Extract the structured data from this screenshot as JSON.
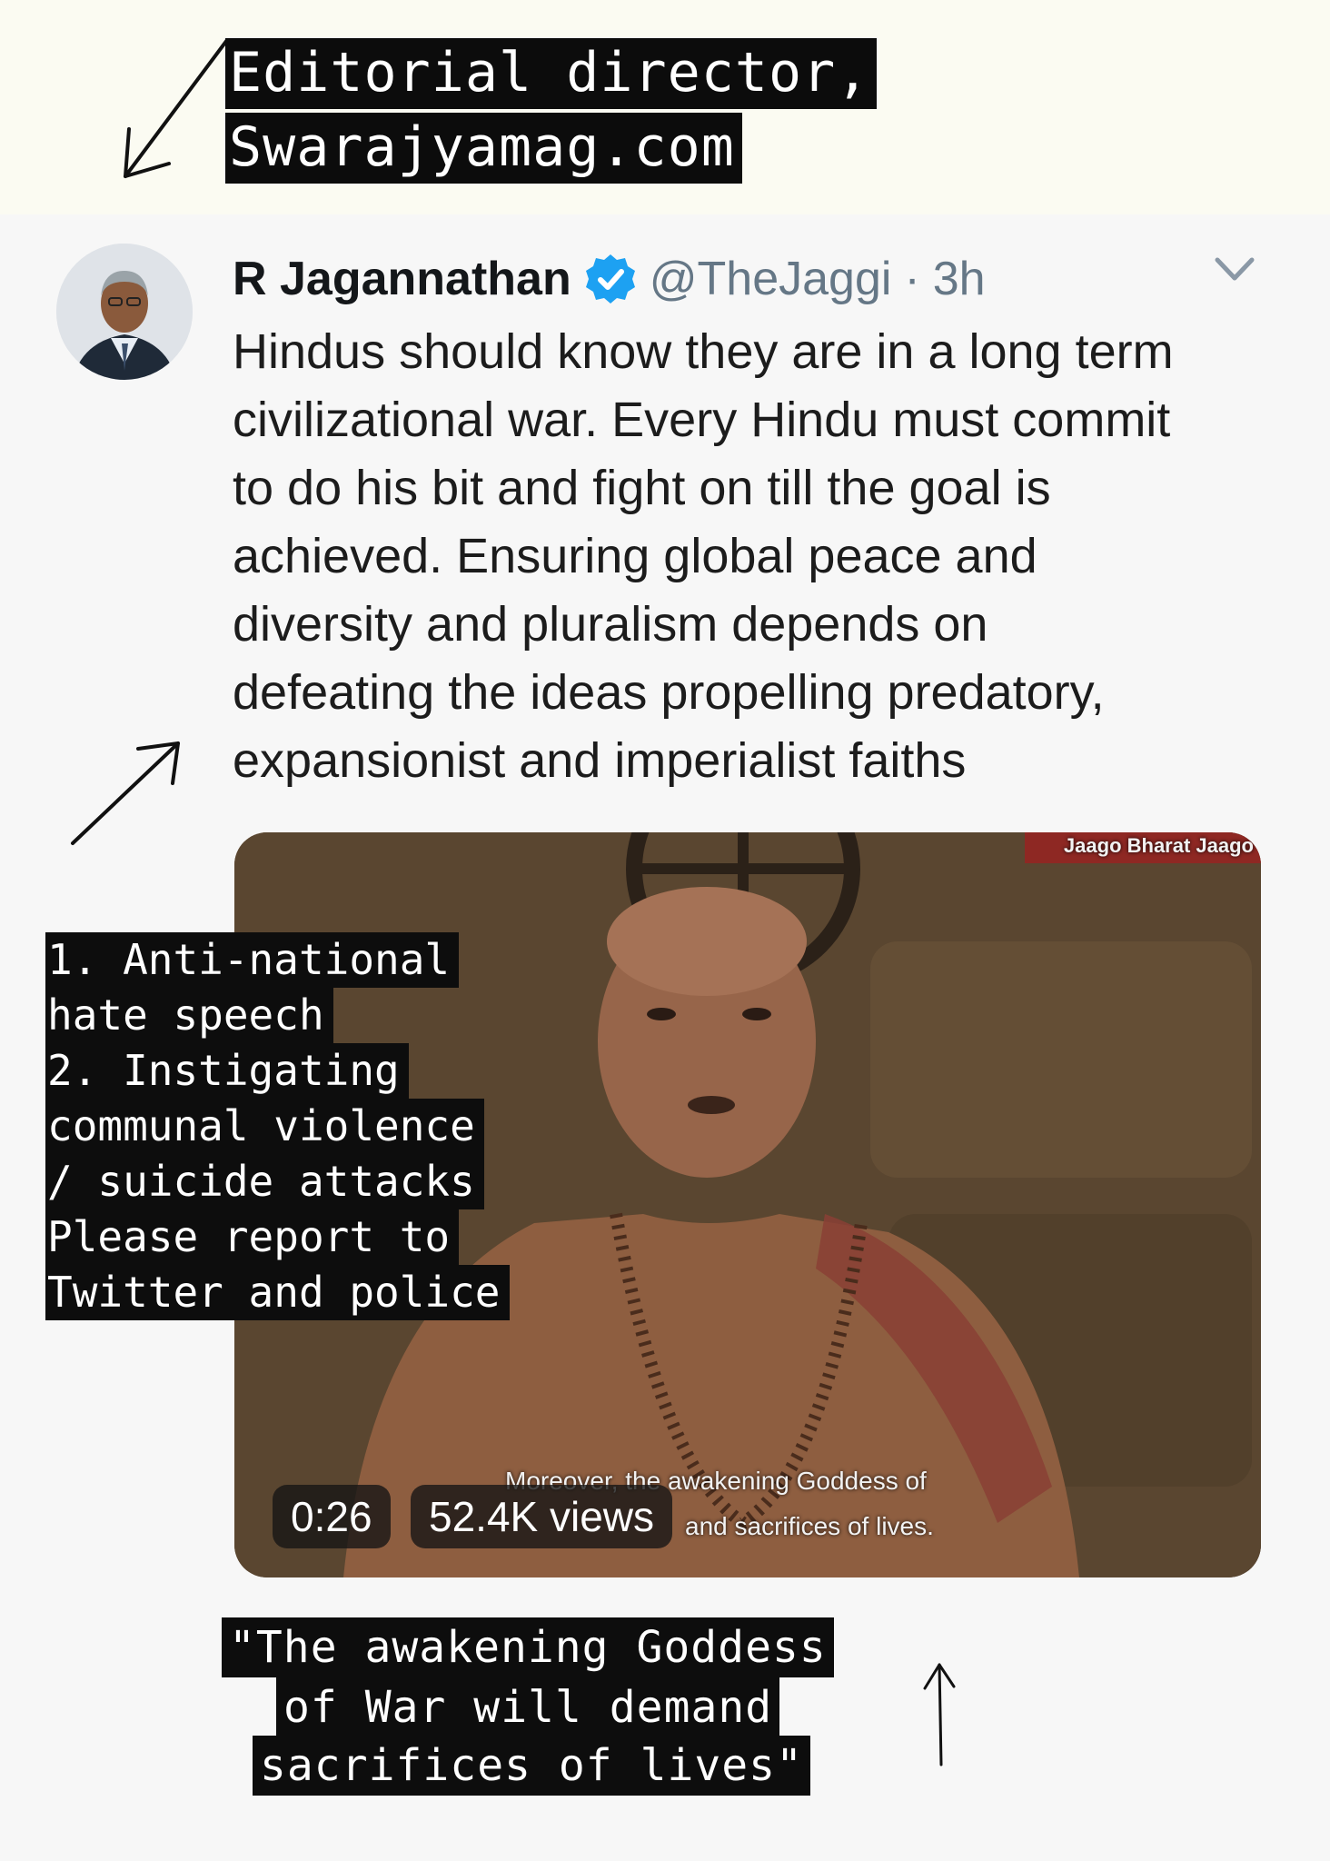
{
  "annotations": {
    "editor_label_line1": "Editorial director,",
    "editor_label_line2": "Swarajyamag.com",
    "warning_lines": [
      "1. Anti-national",
      "hate speech",
      "2. Instigating",
      "communal violence",
      "/ suicide attacks",
      "Please report to",
      "Twitter and police"
    ],
    "quote_lines": [
      "\"The awakening Goddess",
      "of War will demand",
      "sacrifices of lives\""
    ]
  },
  "tweet": {
    "author_name": "R Jagannathan",
    "handle": "@TheJaggi",
    "separator": "·",
    "time": "3h",
    "verified": true,
    "verified_color": "#1da1f2",
    "text_lines": [
      "Hindus should know they are in a long term",
      "civilizational war. Every Hindu must commit",
      "to do his bit and fight on till the goal is",
      "achieved. Ensuring global peace and",
      "diversity and pluralism depends on",
      "defeating the ideas propelling predatory,",
      "expansionist and imperialist faiths"
    ]
  },
  "video": {
    "duration": "0:26",
    "views": "52.4K views",
    "subtitle_line1": "Moreover, the awakening Goddess of",
    "subtitle_line2": "and sacrifices of lives.",
    "channel_watermark": "Jaago Bharat Jaago"
  },
  "icons": {
    "verified": "verified-badge-icon",
    "caret": "chevron-down-icon",
    "arrow": "hand-drawn-arrow-icon"
  }
}
